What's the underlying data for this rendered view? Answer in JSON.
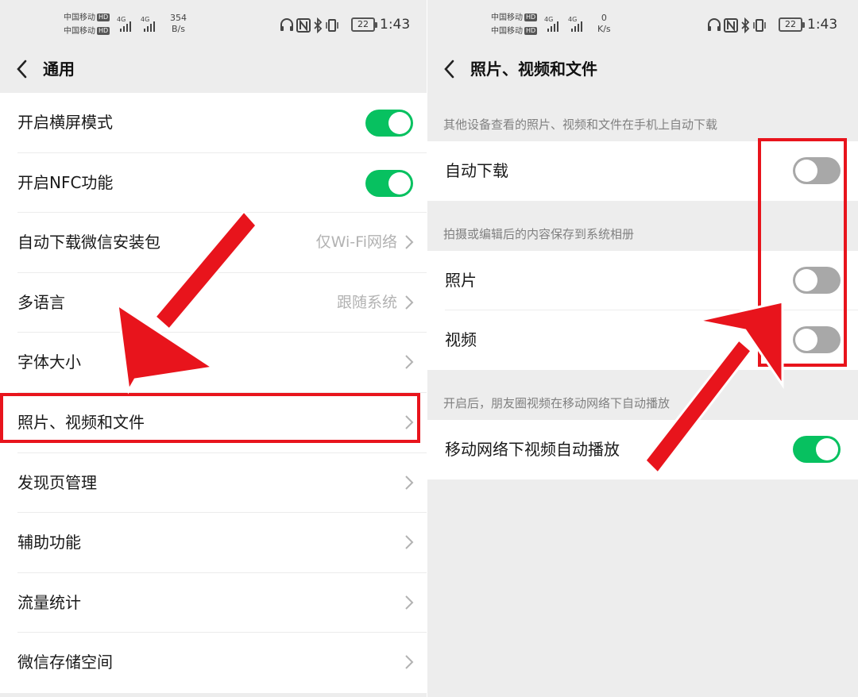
{
  "left": {
    "status": {
      "carrier1": "中国移动",
      "carrier2": "中国移动",
      "hd": "HD",
      "net1": "4G",
      "net2": "4G",
      "speed_value": "354",
      "speed_unit": "B/s",
      "battery": "22",
      "time": "1:43"
    },
    "header": {
      "title": "通用"
    },
    "items": [
      {
        "label": "开启横屏模式",
        "type": "toggle",
        "state": "on"
      },
      {
        "label": "开启NFC功能",
        "type": "toggle",
        "state": "on"
      },
      {
        "label": "自动下载微信安装包",
        "value": "仅Wi-Fi网络",
        "type": "link"
      },
      {
        "label": "多语言",
        "value": "跟随系统",
        "type": "link"
      },
      {
        "label": "字体大小",
        "type": "link"
      },
      {
        "label": "照片、视频和文件",
        "type": "link",
        "highlighted": true
      },
      {
        "label": "发现页管理",
        "type": "link"
      },
      {
        "label": "辅助功能",
        "type": "link"
      },
      {
        "label": "流量统计",
        "type": "link"
      },
      {
        "label": "微信存储空间",
        "type": "link"
      }
    ]
  },
  "right": {
    "status": {
      "carrier1": "中国移动",
      "carrier2": "中国移动",
      "hd": "HD",
      "net1": "4G",
      "net2": "4G",
      "speed_value": "0",
      "speed_unit": "K/s",
      "battery": "22",
      "time": "1:43"
    },
    "header": {
      "title": "照片、视频和文件"
    },
    "section1": {
      "title": "其他设备查看的照片、视频和文件在手机上自动下载",
      "items": [
        {
          "label": "自动下载",
          "state": "off"
        }
      ]
    },
    "section2": {
      "title": "拍摄或编辑后的内容保存到系统相册",
      "items": [
        {
          "label": "照片",
          "state": "off"
        },
        {
          "label": "视频",
          "state": "off"
        }
      ]
    },
    "section3": {
      "title": "开启后，朋友圈视频在移动网络下自动播放",
      "items": [
        {
          "label": "移动网络下视频自动播放",
          "state": "on"
        }
      ]
    }
  },
  "colors": {
    "toggle_on": "#07c160",
    "toggle_off": "#a8a8a8",
    "annotation_red": "#e8141c",
    "background": "#ededed"
  },
  "icons": [
    "back-arrow-icon",
    "chevron-right-icon",
    "headphones-icon",
    "nfc-icon",
    "bluetooth-icon",
    "vibrate-icon",
    "battery-icon",
    "signal-icon"
  ]
}
